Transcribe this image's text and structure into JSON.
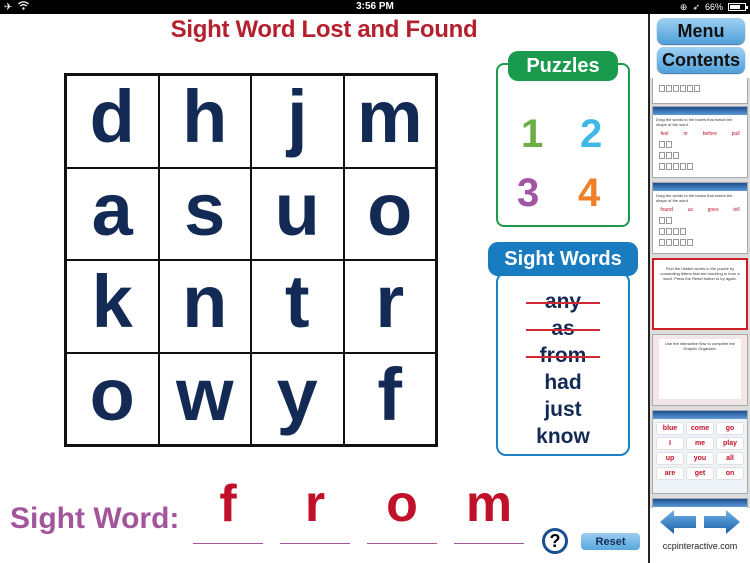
{
  "status_bar": {
    "time": "3:56 PM",
    "battery": "66%",
    "battery_level": 0.66,
    "icons": [
      "airplane-mode-icon",
      "wifi-icon",
      "orientation-lock-icon",
      "location-icon",
      "battery-icon"
    ]
  },
  "title": "Sight Word Lost and Found",
  "grid": {
    "rows": [
      [
        "d",
        "h",
        "j",
        "m"
      ],
      [
        "a",
        "s",
        "u",
        "o"
      ],
      [
        "k",
        "n",
        "t",
        "r"
      ],
      [
        "o",
        "w",
        "y",
        "f"
      ]
    ]
  },
  "puzzles": {
    "header": "Puzzles",
    "items": [
      {
        "label": "1",
        "color": "#6bb043"
      },
      {
        "label": "2",
        "color": "#3fb8e8"
      },
      {
        "label": "3",
        "color": "#a255a4"
      },
      {
        "label": "4",
        "color": "#f07f2a"
      }
    ]
  },
  "sight_words": {
    "header": "Sight Words",
    "items": [
      {
        "word": "any",
        "found": true
      },
      {
        "word": "as",
        "found": true
      },
      {
        "word": "from",
        "found": true
      },
      {
        "word": "had",
        "found": false
      },
      {
        "word": "just",
        "found": false
      },
      {
        "word": "know",
        "found": false
      }
    ]
  },
  "answer": {
    "label": "Sight Word:",
    "letters": [
      "f",
      "r",
      "o",
      "m"
    ]
  },
  "buttons": {
    "help": "?",
    "reset": "Reset"
  },
  "sidebar": {
    "menu": "Menu",
    "contents": "Contents",
    "thumb1_words": [
      "feel",
      "or",
      "before",
      "pull"
    ],
    "thumb2_words": [
      "found",
      "us",
      "goes",
      "tell"
    ],
    "thumb5_words": [
      "blue",
      "come",
      "go",
      "I",
      "me",
      "play",
      "up",
      "you",
      "all",
      "are",
      "get",
      "on"
    ],
    "site": "ccpinteractive.com"
  },
  "colors": {
    "title": "#b5202e",
    "grid_letters": "#132b54",
    "answer_letters": "#c0102a",
    "answer_label": "#a3559c",
    "puzzles_green": "#1a9a4c",
    "sight_words_blue": "#1a7cc0",
    "strike": "#d22a35"
  }
}
